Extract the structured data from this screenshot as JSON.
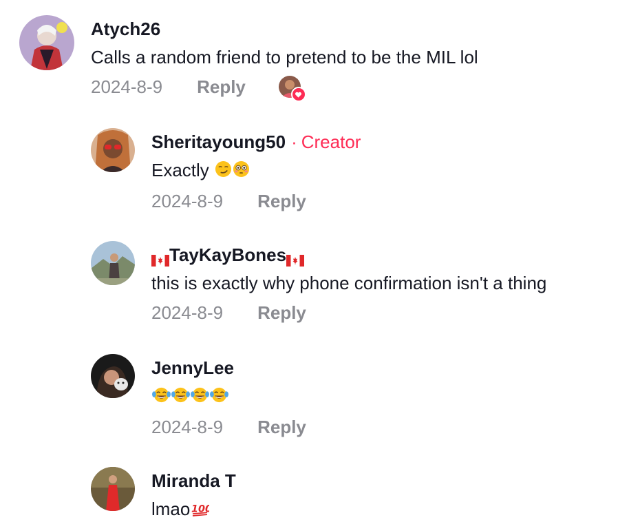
{
  "comments": [
    {
      "username": "Atych26",
      "text": "Calls a random friend to pretend to be the MIL lol",
      "date": "2024-8-9",
      "reply_label": "Reply",
      "liked_by_creator": true
    },
    {
      "username": "Sheritayoung50",
      "creator_separator": "·",
      "creator_label": "Creator",
      "text": "Exactly",
      "emojis": [
        "smirk-face-icon",
        "flushed-face-icon"
      ],
      "date": "2024-8-9",
      "reply_label": "Reply"
    },
    {
      "username": "TayKayBones",
      "flag_icons": [
        "canada-flag-icon",
        "canada-flag-icon"
      ],
      "text": "this is exactly why phone confirmation isn't a thing",
      "date": "2024-8-9",
      "reply_label": "Reply"
    },
    {
      "username": "JennyLee",
      "text": "",
      "emojis": [
        "tears-of-joy-icon",
        "tears-of-joy-icon",
        "tears-of-joy-icon",
        "tears-of-joy-icon"
      ],
      "date": "2024-8-9",
      "reply_label": "Reply"
    },
    {
      "username": "Miranda T",
      "text": "lmao",
      "emojis": [
        "hundred-points-icon"
      ]
    }
  ],
  "colors": {
    "creator_accent": "#fe2c55",
    "meta_gray": "#8a8b91",
    "text": "#161823"
  }
}
